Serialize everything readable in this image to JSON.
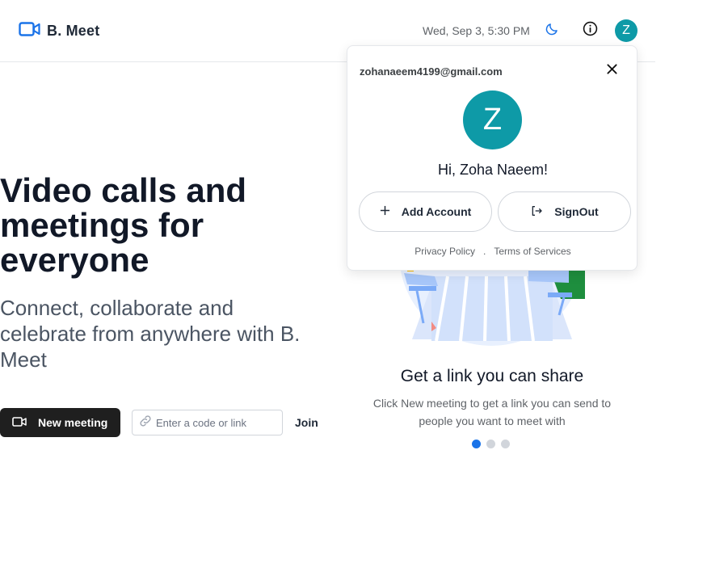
{
  "header": {
    "brand_name": "B. Meet",
    "datetime": "Wed, Sep 3, 5:30 PM",
    "avatar_initial": "Z",
    "icons": [
      "video-camera-icon",
      "moon-icon",
      "info-icon"
    ]
  },
  "hero": {
    "headline": "Video calls and meetings for everyone",
    "subhead": "Connect, collaborate and celebrate from anywhere with B. Meet",
    "new_meeting_label": "New meeting",
    "code_placeholder": "Enter a code or link",
    "join_label": "Join"
  },
  "carousel": {
    "title": "Get a link you can share",
    "description": "Click New meeting to get a link you can send to people you want to meet with",
    "active_index": 0,
    "count": 3
  },
  "account_popover": {
    "email": "zohanaeem4199@gmail.com",
    "avatar_initial": "Z",
    "greeting": "Hi, Zoha Naeem!",
    "add_account_label": "Add Account",
    "signout_label": "SignOut",
    "privacy_label": "Privacy Policy",
    "separator": ".",
    "terms_label": "Terms of Services"
  },
  "colors": {
    "accent": "#1a73e8",
    "avatar": "#0e9aa7",
    "dark_button": "#1f1f1f"
  }
}
